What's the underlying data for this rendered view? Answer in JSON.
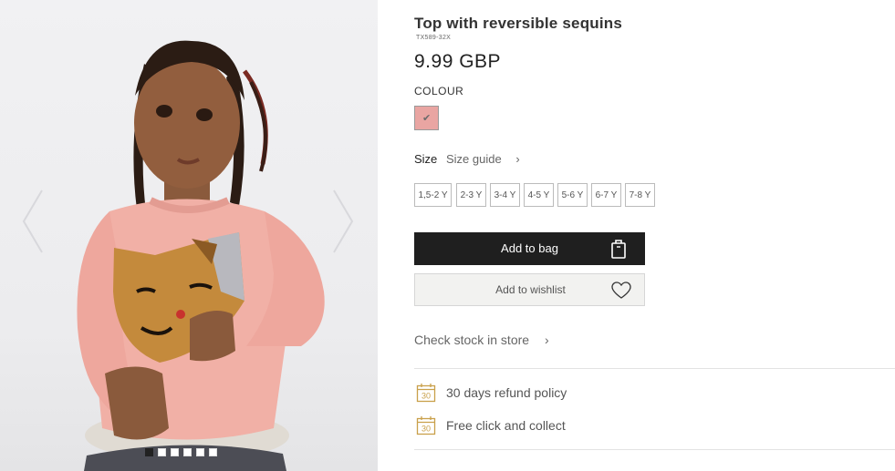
{
  "product": {
    "title": "Top with reversible sequins",
    "sku": "TX589-32X",
    "price": "9.99 GBP"
  },
  "colour": {
    "label": "COLOUR",
    "selected_hex": "#e9a5a2",
    "check_symbol": "✔"
  },
  "size": {
    "label": "Size",
    "guide_label": "Size guide",
    "chevron": "›",
    "options": [
      "1,5-2 Y",
      "2-3 Y",
      "3-4 Y",
      "4-5 Y",
      "5-6 Y",
      "6-7 Y",
      "7-8 Y"
    ]
  },
  "actions": {
    "add_to_bag": "Add to bag",
    "add_to_wishlist": "Add to wishlist",
    "check_stock": "Check stock in store",
    "check_stock_chevron": "›"
  },
  "features": [
    {
      "icon": "calendar-30-icon",
      "number": "30",
      "text": "30 days refund policy"
    },
    {
      "icon": "calendar-30-icon",
      "number": "30",
      "text": "Free click and collect"
    }
  ],
  "gallery": {
    "image_count": 6,
    "active_index": 0
  },
  "colors": {
    "primary_button": "#1f1f1f",
    "icon_gold": "#c9a04a"
  }
}
